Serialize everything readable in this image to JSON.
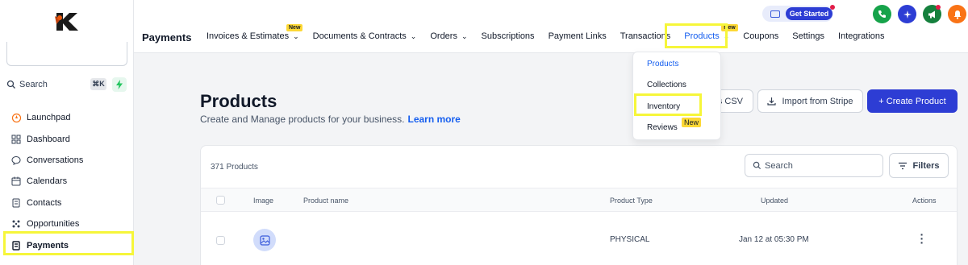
{
  "sidebar": {
    "search_label": "Search",
    "search_shortcut": "⌘K",
    "items": [
      {
        "label": "Launchpad",
        "icon": "rocket-icon"
      },
      {
        "label": "Dashboard",
        "icon": "grid-icon"
      },
      {
        "label": "Conversations",
        "icon": "chat-icon"
      },
      {
        "label": "Calendars",
        "icon": "calendar-icon"
      },
      {
        "label": "Contacts",
        "icon": "contacts-icon"
      },
      {
        "label": "Opportunities",
        "icon": "opportunities-icon"
      },
      {
        "label": "Payments",
        "icon": "payments-icon",
        "active": true
      }
    ]
  },
  "header": {
    "section_title": "Payments",
    "get_started": "Get Started",
    "tabs": [
      {
        "label": "Invoices & Estimates",
        "dropdown": true,
        "badge": "New"
      },
      {
        "label": "Documents & Contracts",
        "dropdown": true
      },
      {
        "label": "Orders",
        "dropdown": true
      },
      {
        "label": "Subscriptions"
      },
      {
        "label": "Payment Links"
      },
      {
        "label": "Transactions"
      },
      {
        "label": "Products",
        "dropdown": true,
        "badge": "New",
        "active": true
      },
      {
        "label": "Coupons"
      },
      {
        "label": "Settings"
      },
      {
        "label": "Integrations"
      }
    ]
  },
  "dropdown": {
    "items": [
      "Products",
      "Collections",
      "Inventory",
      "Reviews"
    ],
    "reviews_badge": "New"
  },
  "main": {
    "title": "Products",
    "subtitle": "Create and Manage products for your business.",
    "learn_more": "Learn more",
    "export_csv_partial": "s CSV",
    "import_stripe": "Import from Stripe",
    "create_product": "+ Create Product"
  },
  "table": {
    "count": "371 Products",
    "search_placeholder": "Search",
    "filters": "Filters",
    "headers": [
      "Image",
      "Product name",
      "Product Type",
      "Updated",
      "Actions"
    ],
    "rows": [
      {
        "product_type": "PHYSICAL",
        "updated": "Jan 12 at 05:30 PM"
      }
    ]
  },
  "colors": {
    "accent": "#155eef",
    "primary_button": "#2d3dd4",
    "highlight": "#f6f63a",
    "badge": "#fdd835"
  }
}
